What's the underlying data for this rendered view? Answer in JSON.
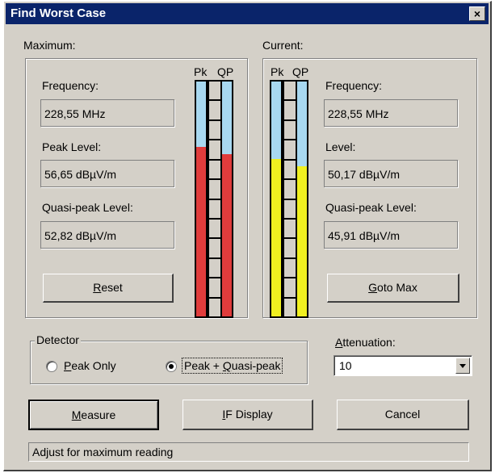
{
  "window": {
    "title": "Find Worst Case",
    "close_glyph": "×"
  },
  "maximum": {
    "group_label": "Maximum:",
    "frequency_label": "Frequency:",
    "frequency_value": "228,55 MHz",
    "peak_label": "Peak Level:",
    "peak_value": "56,65 dBµV/m",
    "qp_label": "Quasi-peak Level:",
    "qp_value": "52,82 dBµV/m",
    "reset_label_prefix": "",
    "reset_label_mnemonic": "R",
    "reset_label_rest": "eset"
  },
  "current": {
    "group_label": "Current:",
    "frequency_label": "Frequency:",
    "frequency_value": "228,55 MHz",
    "level_label": "Level:",
    "level_value": "50,17 dBµV/m",
    "qp_label": "Quasi-peak Level:",
    "qp_value": "45,91 dBµV/m",
    "goto_label_mnemonic": "G",
    "goto_label_rest": "oto Max"
  },
  "meters": {
    "max_pk_header": "Pk",
    "max_qp_header": "QP",
    "cur_pk_header": "Pk",
    "cur_qp_header": "QP",
    "max_pk_fraction": 0.72,
    "max_qp_fraction": 0.69,
    "cur_pk_fraction": 0.67,
    "cur_qp_fraction": 0.64,
    "colors": {
      "empty": "#a8d8f0",
      "max_fill": "#e03c3c",
      "cur_fill": "#f0f020"
    }
  },
  "detector": {
    "group_label": "Detector",
    "option1_mnemonic": "P",
    "option1_rest": "eak Only",
    "option2_prefix": "Peak + ",
    "option2_mnemonic": "Q",
    "option2_rest": "uasi-peak",
    "selected": "Peak + Quasi-peak"
  },
  "attenuation": {
    "label_mnemonic": "A",
    "label_rest": "ttenuation:",
    "value": "10"
  },
  "buttons": {
    "measure_mnemonic": "M",
    "measure_rest": "easure",
    "ifdisplay_mnemonic": "I",
    "ifdisplay_rest": "F Display",
    "cancel": "Cancel"
  },
  "status_text": "Adjust for maximum reading"
}
